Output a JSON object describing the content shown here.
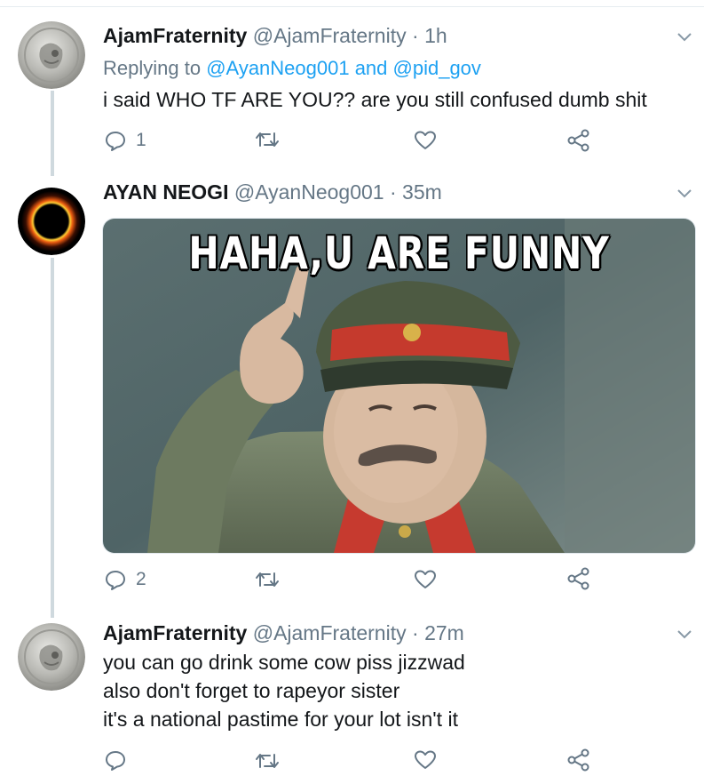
{
  "tweets": [
    {
      "name": "AjamFraternity",
      "handle": "@AjamFraternity",
      "separator": "·",
      "time": "1h",
      "reply_prefix": "Replying to",
      "reply_targets": "@AyanNeog001 and @pid_gov",
      "text_lines": [
        "i said WHO TF ARE YOU?? are you still confused dumb shit"
      ],
      "reply_count": "1",
      "icons": [
        "reply-icon",
        "retweet-icon",
        "like-icon",
        "share-icon",
        "chevron-down-icon"
      ]
    },
    {
      "name": "AYAN NEOGI",
      "handle": "@AyanNeog001",
      "separator": "·",
      "time": "35m",
      "media_caption": "HAHA,U ARE FUNNY",
      "reply_count": "2",
      "icons": [
        "reply-icon",
        "retweet-icon",
        "like-icon",
        "share-icon",
        "chevron-down-icon"
      ]
    },
    {
      "name": "AjamFraternity",
      "handle": "@AjamFraternity",
      "separator": "·",
      "time": "27m",
      "text_lines": [
        "you can go drink some cow piss jizzwad",
        "also don't forget to rapeyor sister",
        "it's a national pastime for your lot isn't it"
      ],
      "reply_count": "",
      "icons": [
        "reply-icon",
        "retweet-icon",
        "like-icon",
        "share-icon",
        "chevron-down-icon"
      ]
    }
  ],
  "colors": {
    "link": "#1da1f2",
    "secondary_text": "#657786",
    "thread_line": "#cfd9de"
  }
}
